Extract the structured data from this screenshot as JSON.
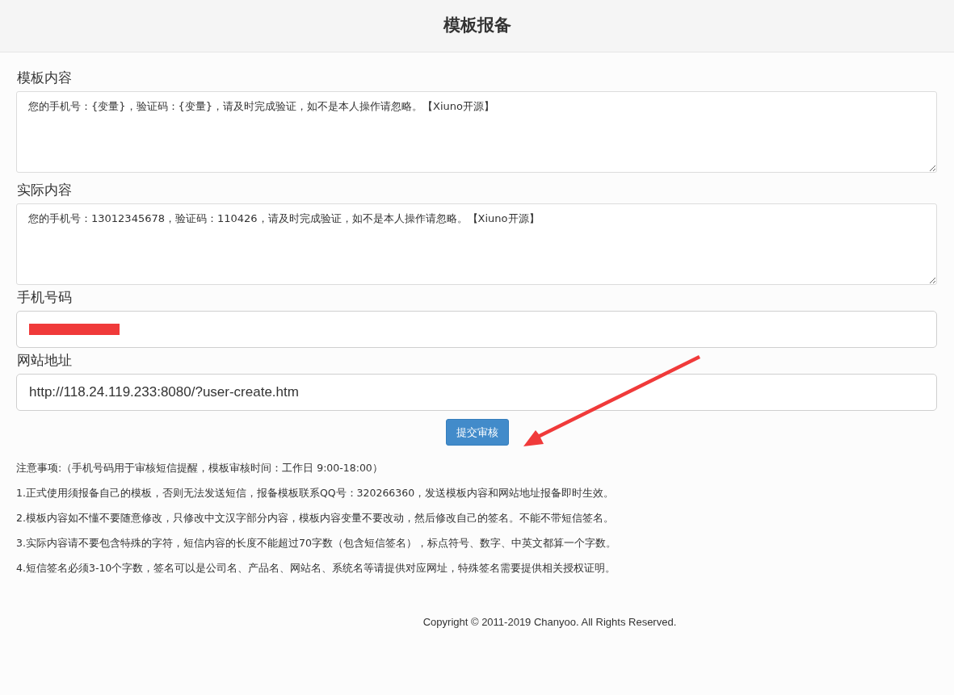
{
  "header": {
    "title": "模板报备"
  },
  "form": {
    "fields": [
      {
        "kind": "textarea",
        "label": "模板内容",
        "value": "您的手机号：{变量}，验证码：{变量}，请及时完成验证，如不是本人操作请忽略。【Xiuno开源】"
      },
      {
        "kind": "textarea",
        "label": "实际内容",
        "value": "您的手机号：13012345678，验证码：110426，请及时完成验证，如不是本人操作请忽略。【Xiuno开源】"
      },
      {
        "kind": "redacted",
        "label": "手机号码"
      },
      {
        "kind": "input",
        "label": "网站地址",
        "value": "http://118.24.119.233:8080/?user-create.htm"
      }
    ],
    "submit_button": "提交审核"
  },
  "notes": [
    "注意事项:（手机号码用于审核短信提醒，模板审核时间：工作日 9:00-18:00）",
    "1.正式使用须报备自己的模板，否则无法发送短信，报备模板联系QQ号：320266360，发送模板内容和网站地址报备即时生效。",
    "2.模板内容如不懂不要随意修改，只修改中文汉字部分内容，模板内容变量不要改动，然后修改自己的签名。不能不带短信签名。",
    "3.实际内容请不要包含特殊的字符，短信内容的长度不能超过70字数（包含短信签名），标点符号、数字、中英文都算一个字数。",
    "4.短信签名必须3-10个字数，签名可以是公司名、产品名、网站名、系统名等请提供对应网址，特殊签名需要提供相关授权证明。"
  ],
  "footer": "Copyright © 2011-2019 Chanyoo. All Rights Reserved."
}
